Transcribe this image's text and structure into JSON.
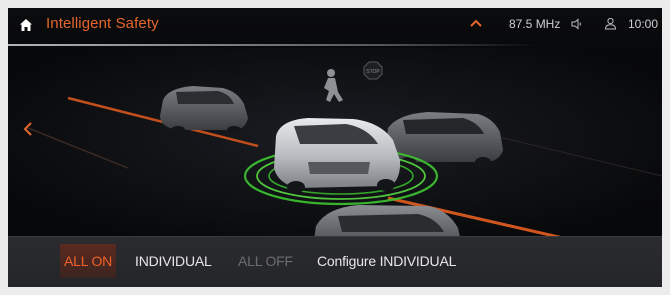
{
  "header": {
    "title": "Intelligent Safety",
    "radio_frequency": "87.5 MHz",
    "time": "10:00",
    "colors": {
      "accent": "#e5662c",
      "text": "#d0d0d0"
    }
  },
  "scene": {
    "description_icons": [
      "car-icon",
      "pedestrian-icon",
      "stop-sign-icon"
    ]
  },
  "options": [
    {
      "label": "ALL ON",
      "state": "selected"
    },
    {
      "label": "INDIVIDUAL",
      "state": "normal"
    },
    {
      "label": "ALL OFF",
      "state": "disabled"
    },
    {
      "label": "Configure INDIVIDUAL",
      "state": "normal"
    }
  ]
}
